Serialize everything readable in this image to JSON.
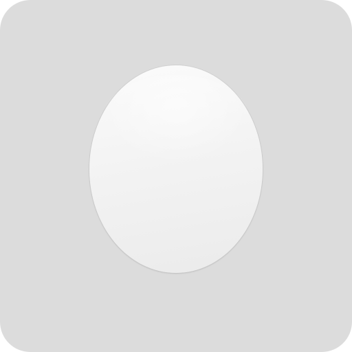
{
  "icon": {
    "name": "egg-icon",
    "background_color": "#dcdcdc",
    "shape_color": "#f3f3f3"
  }
}
